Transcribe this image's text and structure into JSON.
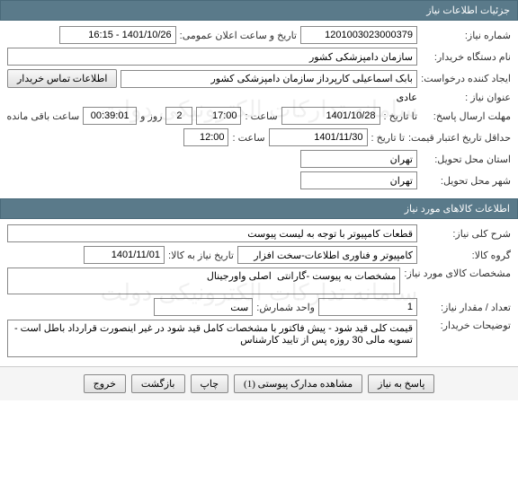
{
  "header1": "جزئیات اطلاعات نیاز",
  "header2": "اطلاعات کالاهای مورد نیاز",
  "labels": {
    "need_no": "شماره نیاز:",
    "announce_dt": "تاریخ و ساعت اعلان عمومی:",
    "buyer_org": "نام دستگاه خریدار:",
    "requester": "ایجاد کننده درخواست:",
    "contact_btn": "اطلاعات تماس خریدار",
    "need_title": "عنوان نیاز :",
    "reply_deadline": "مهلت ارسال پاسخ:",
    "to_date": "تا تاریخ :",
    "time": "ساعت :",
    "days_and": "روز و",
    "time_left": "ساعت باقی مانده",
    "min_validity": "حداقل تاریخ اعتبار قیمت:",
    "to_date2": "تا تاریخ :",
    "delivery_prov": "استان محل تحویل:",
    "delivery_city": "شهر محل تحویل:",
    "gen_desc": "شرح کلی نیاز:",
    "goods_group": "گروه کالا:",
    "need_date": "تاریخ نیاز به کالا:",
    "goods_spec": "مشخصات کالای مورد نیاز:",
    "qty": "تعداد / مقدار نیاز:",
    "unit": "واحد شمارش:",
    "buyer_notes": "توضیحات خریدار:"
  },
  "values": {
    "need_no": "1201003023000379",
    "announce_dt": "1401/10/26 - 16:15",
    "buyer_org": "سازمان دامپزشکی کشور",
    "requester": "بابک اسماعیلی کارپرداز سازمان دامپزشکی کشور",
    "need_title": "عادی",
    "reply_date": "1401/10/28",
    "reply_time": "17:00",
    "days_left": "2",
    "countdown": "00:39:01",
    "validity_date": "1401/11/30",
    "validity_time": "12:00",
    "province": "تهران",
    "city": "تهران",
    "gen_desc": "قطعات کامپیوتر با توجه به لیست پیوست",
    "goods_group": "کامپیوتر و فناوری اطلاعات-سخت افزار",
    "need_date": "1401/11/01",
    "goods_spec": "مشخصات به پیوست -گارانتی  اصلی واورجینال",
    "qty": "1",
    "unit": "ست",
    "buyer_notes": "قیمت کلی قید شود - پیش فاکتور با مشخصات کامل قید شود در غیر اینصورت قرارداد باطل است - تسویه مالی 30 روزه پس از تایید کارشناس"
  },
  "buttons": {
    "reply": "پاسخ به نیاز",
    "attachments": "مشاهده مدارک پیوستی (1)",
    "print": "چاپ",
    "back": "بازگشت",
    "exit": "خروج"
  },
  "watermark": "سامانه تدارکات الکترونیکی دولت"
}
